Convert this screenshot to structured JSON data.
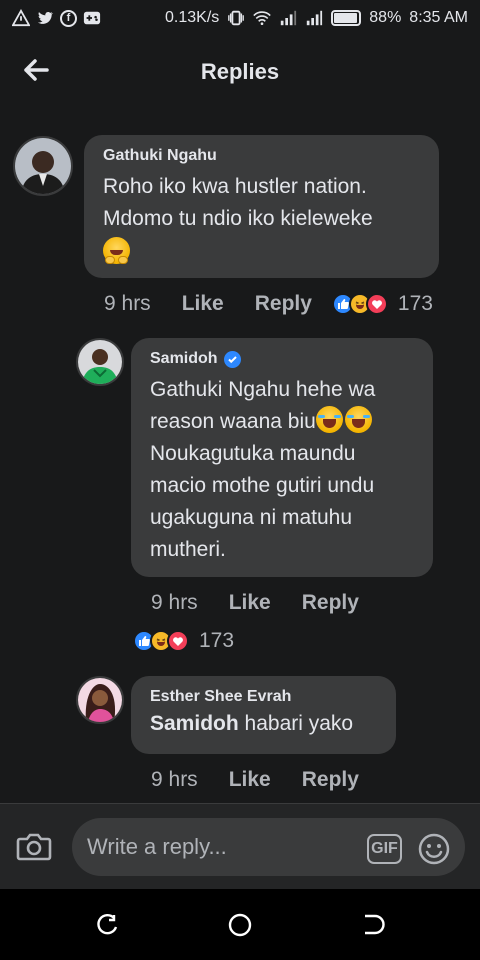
{
  "status_bar": {
    "speed": "0.13K/s",
    "battery": "88%",
    "battery_level": 0.88,
    "time": "8:35 AM",
    "icons": [
      "alert-triangle-icon",
      "twitter-icon",
      "facebook-icon",
      "gamepad-icon",
      "vibrate-icon",
      "wifi-icon",
      "signal-icon",
      "signal-icon",
      "battery-icon"
    ]
  },
  "header": {
    "title": "Replies",
    "back_icon": "arrow-left-icon"
  },
  "comments": [
    {
      "author": "Gathuki Ngahu",
      "verified": false,
      "lines": [
        "Roho iko kwa hustler nation.",
        "Mdomo tu ndio iko kieleweke"
      ],
      "emoji": "smiling-hands-emoji",
      "time": "9 hrs",
      "like": "Like",
      "reply": "Reply",
      "reactions": [
        "like",
        "haha",
        "love"
      ],
      "reaction_count": "173"
    },
    {
      "author": "Samidoh",
      "verified": true,
      "lines": [
        "Gathuki Ngahu hehe wa",
        "reason waana biu",
        "Noukagutuka maundu",
        "macio mothe gutiri undu",
        "ugakuguna ni matuhu",
        "mutheri."
      ],
      "emoji": "tears-of-joy-emoji",
      "time": "9 hrs",
      "like": "Like",
      "reply": "Reply",
      "reactions": [
        "like",
        "haha",
        "love"
      ],
      "reaction_count": "173"
    },
    {
      "author": "Esther Shee Evrah",
      "verified": false,
      "mention": "Samidoh",
      "text": "habari yako",
      "time": "9 hrs",
      "like": "Like",
      "reply": "Reply"
    }
  ],
  "composer": {
    "placeholder": "Write a reply...",
    "gif": "GIF",
    "camera_icon": "camera-icon",
    "emoji_icon": "smiley-icon"
  },
  "nav": {
    "icons": [
      "recent-apps-icon",
      "home-icon",
      "back-icon"
    ]
  },
  "colors": {
    "background": "#18191a",
    "bubble": "#3a3b3c",
    "text": "#e4e6eb",
    "muted": "#b0b3b8",
    "accent": "#2d88ff"
  }
}
